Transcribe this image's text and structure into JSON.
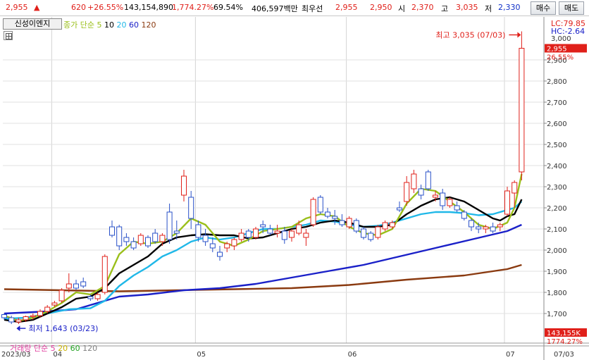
{
  "quote": {
    "price": "2,955",
    "change_arrow": "▲",
    "change": "620",
    "change_pct": "+26.55%",
    "volume": "143,154,890",
    "volume_ratio": "1,774.27%",
    "turnover": "69.54%",
    "value": "406,597백만",
    "best_label": "최우선",
    "best_ask": "2,955",
    "best_bid": "2,950",
    "open_label": "시",
    "open": "2,370",
    "high_label": "고",
    "high": "3,035",
    "low_label": "저",
    "low": "2,330",
    "buy_button": "매수",
    "sell_button": "매도"
  },
  "toolbar": {
    "engine_button": "신성이엔지",
    "grid_icon": "grid-icon"
  },
  "ma_legend": {
    "prefix": "종가 단순",
    "periods": [
      "5",
      "10",
      "20",
      "60",
      "120"
    ],
    "colors": [
      "#9abf1a",
      "#000000",
      "#20b8e8",
      "#1a20c8",
      "#8a3a10"
    ]
  },
  "vol_legend": {
    "prefix": "거래량 단순",
    "periods": [
      "5",
      "20",
      "60",
      "120"
    ],
    "colors": [
      "#e040a0",
      "#c8b000",
      "#20a020",
      "#808080"
    ]
  },
  "right_axis": {
    "lc": "LC:79.85",
    "hc": "HC:-2.64",
    "top_label": "3,000",
    "current_price": "2,955",
    "current_pct": "26.55%",
    "current_color": "#e0201a",
    "volume_box": "143,155K",
    "volume_pct": "1774.27%"
  },
  "annotations": {
    "high": "최고 3,035 (07/03)",
    "low": "최저 1,643 (03/23)"
  },
  "x_axis": {
    "labels": [
      {
        "text": "2023/03",
        "i": 0
      },
      {
        "text": "04",
        "i": 7
      },
      {
        "text": "05",
        "i": 27
      },
      {
        "text": "06",
        "i": 48
      },
      {
        "text": "07",
        "i": 70
      }
    ],
    "cursor_label": "07/03"
  },
  "chart_data": {
    "type": "candlestick",
    "y_ticks": [
      2900,
      2800,
      2700,
      2600,
      2500,
      2400,
      2300,
      2200,
      2100,
      2000,
      1900,
      1800,
      1700
    ],
    "ylim": [
      1630,
      3080
    ],
    "up_color": "#e0201a",
    "down_color": "#2850c8",
    "candles": [
      [
        1695,
        1700,
        1670,
        1680
      ],
      [
        1680,
        1690,
        1650,
        1660
      ],
      [
        1660,
        1680,
        1650,
        1670
      ],
      [
        1670,
        1690,
        1660,
        1685
      ],
      [
        1685,
        1700,
        1670,
        1690
      ],
      [
        1690,
        1720,
        1680,
        1710
      ],
      [
        1710,
        1740,
        1700,
        1730
      ],
      [
        1740,
        1760,
        1730,
        1750
      ],
      [
        1760,
        1820,
        1750,
        1810
      ],
      [
        1820,
        1890,
        1800,
        1840
      ],
      [
        1840,
        1860,
        1810,
        1820
      ],
      [
        1850,
        1870,
        1820,
        1830
      ],
      [
        1780,
        1790,
        1760,
        1770
      ],
      [
        1770,
        1800,
        1760,
        1790
      ],
      [
        1800,
        1980,
        1790,
        1970
      ],
      [
        2110,
        2140,
        2060,
        2070
      ],
      [
        2110,
        2120,
        2000,
        2020
      ],
      [
        2060,
        2080,
        2020,
        2040
      ],
      [
        2040,
        2060,
        2000,
        2010
      ],
      [
        2030,
        2080,
        2020,
        2070
      ],
      [
        2060,
        2070,
        2010,
        2020
      ],
      [
        2080,
        2100,
        2030,
        2040
      ],
      [
        2040,
        2080,
        2020,
        2070
      ],
      [
        2180,
        2220,
        2030,
        2050
      ],
      [
        2090,
        2140,
        2050,
        2080
      ],
      [
        2260,
        2380,
        2230,
        2350
      ],
      [
        2250,
        2280,
        2100,
        2150
      ],
      [
        2120,
        2140,
        2040,
        2060
      ],
      [
        2070,
        2100,
        2020,
        2040
      ],
      [
        2030,
        2060,
        1990,
        2010
      ],
      [
        1990,
        2020,
        1950,
        1970
      ],
      [
        2010,
        2040,
        1990,
        2030
      ],
      [
        2020,
        2060,
        2000,
        2050
      ],
      [
        2050,
        2100,
        2040,
        2080
      ],
      [
        2090,
        2100,
        2040,
        2060
      ],
      [
        2060,
        2110,
        2050,
        2100
      ],
      [
        2120,
        2140,
        2080,
        2110
      ],
      [
        2100,
        2120,
        2070,
        2080
      ],
      [
        2080,
        2120,
        2060,
        2090
      ],
      [
        2090,
        2110,
        2030,
        2050
      ],
      [
        2060,
        2100,
        2040,
        2090
      ],
      [
        2080,
        2140,
        2070,
        2120
      ],
      [
        2060,
        2100,
        2020,
        2080
      ],
      [
        2120,
        2250,
        2110,
        2240
      ],
      [
        2250,
        2260,
        2170,
        2180
      ],
      [
        2180,
        2200,
        2150,
        2160
      ],
      [
        2160,
        2190,
        2120,
        2150
      ],
      [
        2140,
        2170,
        2110,
        2120
      ],
      [
        2110,
        2160,
        2100,
        2150
      ],
      [
        2140,
        2150,
        2080,
        2090
      ],
      [
        2100,
        2110,
        2050,
        2060
      ],
      [
        2080,
        2090,
        2040,
        2050
      ],
      [
        2060,
        2120,
        2050,
        2110
      ],
      [
        2100,
        2140,
        2090,
        2130
      ],
      [
        2110,
        2140,
        2100,
        2130
      ],
      [
        2200,
        2230,
        2180,
        2190
      ],
      [
        2230,
        2350,
        2210,
        2320
      ],
      [
        2290,
        2380,
        2270,
        2360
      ],
      [
        2290,
        2310,
        2240,
        2260
      ],
      [
        2370,
        2380,
        2280,
        2290
      ],
      [
        2250,
        2280,
        2230,
        2260
      ],
      [
        2270,
        2290,
        2190,
        2210
      ],
      [
        2210,
        2250,
        2200,
        2240
      ],
      [
        2210,
        2230,
        2180,
        2190
      ],
      [
        2180,
        2190,
        2140,
        2150
      ],
      [
        2140,
        2150,
        2090,
        2110
      ],
      [
        2110,
        2130,
        2080,
        2100
      ],
      [
        2100,
        2120,
        2080,
        2110
      ],
      [
        2110,
        2130,
        2080,
        2090
      ],
      [
        2110,
        2130,
        2090,
        2120
      ],
      [
        2170,
        2300,
        2160,
        2280
      ],
      [
        2270,
        2330,
        2200,
        2320
      ],
      [
        2370,
        3035,
        2330,
        2955
      ]
    ],
    "ma5": [
      [
        0,
        1690
      ],
      [
        2,
        1665
      ],
      [
        4,
        1680
      ],
      [
        6,
        1710
      ],
      [
        8,
        1750
      ],
      [
        10,
        1800
      ],
      [
        12,
        1790
      ],
      [
        14,
        1830
      ],
      [
        16,
        1980
      ],
      [
        18,
        2040
      ],
      [
        20,
        2030
      ],
      [
        22,
        2040
      ],
      [
        24,
        2080
      ],
      [
        26,
        2150
      ],
      [
        28,
        2120
      ],
      [
        30,
        2040
      ],
      [
        32,
        2020
      ],
      [
        34,
        2050
      ],
      [
        36,
        2090
      ],
      [
        38,
        2100
      ],
      [
        40,
        2110
      ],
      [
        42,
        2150
      ],
      [
        44,
        2170
      ],
      [
        46,
        2160
      ],
      [
        48,
        2110
      ],
      [
        50,
        2080
      ],
      [
        52,
        2070
      ],
      [
        54,
        2100
      ],
      [
        56,
        2220
      ],
      [
        58,
        2290
      ],
      [
        60,
        2280
      ],
      [
        62,
        2230
      ],
      [
        64,
        2180
      ],
      [
        66,
        2120
      ],
      [
        68,
        2100
      ],
      [
        70,
        2130
      ],
      [
        71,
        2200
      ],
      [
        72,
        2360
      ]
    ],
    "ma10": [
      [
        0,
        1670
      ],
      [
        2,
        1660
      ],
      [
        4,
        1670
      ],
      [
        6,
        1700
      ],
      [
        8,
        1730
      ],
      [
        10,
        1770
      ],
      [
        12,
        1780
      ],
      [
        14,
        1820
      ],
      [
        16,
        1890
      ],
      [
        18,
        1930
      ],
      [
        20,
        1970
      ],
      [
        22,
        2030
      ],
      [
        24,
        2060
      ],
      [
        26,
        2070
      ],
      [
        28,
        2075
      ],
      [
        30,
        2070
      ],
      [
        32,
        2070
      ],
      [
        34,
        2055
      ],
      [
        36,
        2060
      ],
      [
        38,
        2080
      ],
      [
        40,
        2100
      ],
      [
        42,
        2110
      ],
      [
        44,
        2130
      ],
      [
        46,
        2140
      ],
      [
        48,
        2130
      ],
      [
        50,
        2110
      ],
      [
        52,
        2110
      ],
      [
        54,
        2120
      ],
      [
        56,
        2170
      ],
      [
        58,
        2210
      ],
      [
        60,
        2240
      ],
      [
        62,
        2250
      ],
      [
        64,
        2230
      ],
      [
        66,
        2190
      ],
      [
        68,
        2150
      ],
      [
        69,
        2140
      ],
      [
        70,
        2160
      ],
      [
        71,
        2170
      ],
      [
        72,
        2240
      ]
    ],
    "ma20": [
      [
        0,
        1675
      ],
      [
        3,
        1680
      ],
      [
        6,
        1700
      ],
      [
        9,
        1720
      ],
      [
        12,
        1725
      ],
      [
        14,
        1760
      ],
      [
        16,
        1830
      ],
      [
        18,
        1880
      ],
      [
        20,
        1920
      ],
      [
        22,
        1970
      ],
      [
        24,
        2000
      ],
      [
        26,
        2040
      ],
      [
        28,
        2060
      ],
      [
        30,
        2050
      ],
      [
        32,
        2060
      ],
      [
        34,
        2080
      ],
      [
        36,
        2100
      ],
      [
        38,
        2100
      ],
      [
        40,
        2110
      ],
      [
        42,
        2120
      ],
      [
        44,
        2140
      ],
      [
        46,
        2135
      ],
      [
        48,
        2120
      ],
      [
        50,
        2110
      ],
      [
        52,
        2115
      ],
      [
        54,
        2130
      ],
      [
        56,
        2150
      ],
      [
        58,
        2170
      ],
      [
        60,
        2180
      ],
      [
        62,
        2180
      ],
      [
        64,
        2175
      ],
      [
        66,
        2165
      ],
      [
        68,
        2170
      ],
      [
        70,
        2190
      ],
      [
        71,
        2200
      ],
      [
        72,
        2230
      ]
    ],
    "ma60": [
      [
        0,
        1700
      ],
      [
        6,
        1710
      ],
      [
        10,
        1720
      ],
      [
        16,
        1780
      ],
      [
        20,
        1790
      ],
      [
        25,
        1810
      ],
      [
        30,
        1820
      ],
      [
        35,
        1840
      ],
      [
        40,
        1870
      ],
      [
        45,
        1900
      ],
      [
        50,
        1930
      ],
      [
        55,
        1970
      ],
      [
        60,
        2010
      ],
      [
        65,
        2050
      ],
      [
        70,
        2090
      ],
      [
        72,
        2120
      ]
    ],
    "ma120": [
      [
        0,
        1815
      ],
      [
        8,
        1810
      ],
      [
        16,
        1805
      ],
      [
        24,
        1810
      ],
      [
        32,
        1815
      ],
      [
        40,
        1820
      ],
      [
        48,
        1835
      ],
      [
        56,
        1860
      ],
      [
        64,
        1880
      ],
      [
        70,
        1910
      ],
      [
        72,
        1930
      ]
    ]
  }
}
